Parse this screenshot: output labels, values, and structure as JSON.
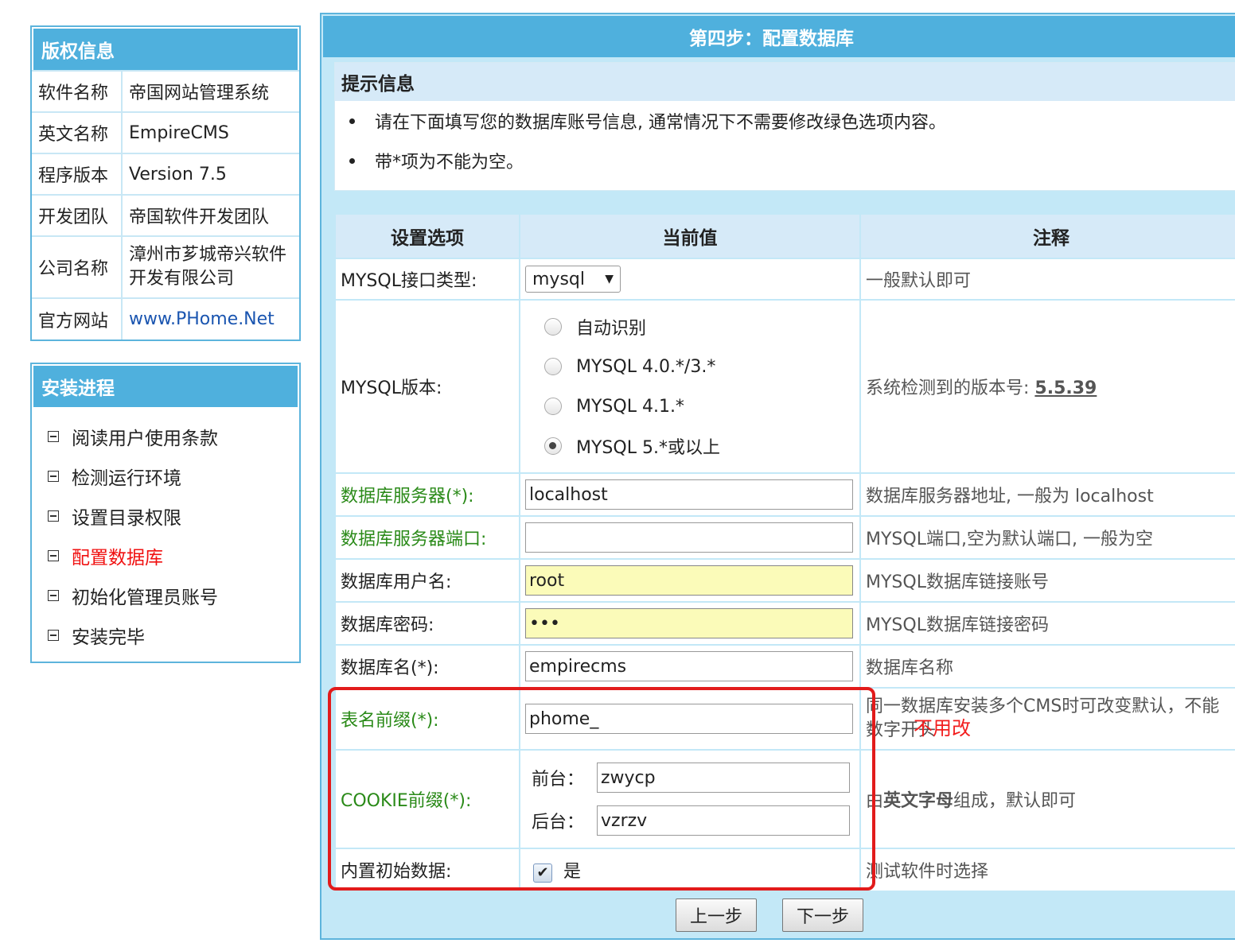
{
  "copyright": {
    "title": "版权信息",
    "rows": [
      {
        "key": "软件名称",
        "value": "帝国网站管理系统"
      },
      {
        "key": "英文名称",
        "value": "EmpireCMS"
      },
      {
        "key": "程序版本",
        "value": "Version 7.5"
      },
      {
        "key": "开发团队",
        "value": "帝国软件开发团队"
      },
      {
        "key": "公司名称",
        "value": "漳州市芗城帝兴软件开发有限公司"
      },
      {
        "key": "官方网站",
        "value": "www.PHome.Net"
      }
    ]
  },
  "progress": {
    "title": "安装进程",
    "steps": [
      "阅读用户使用条款",
      "检测运行环境",
      "设置目录权限",
      "配置数据库",
      "初始化管理员账号",
      "安装完毕"
    ],
    "active_index": 3,
    "active_color": "#f01010"
  },
  "main": {
    "title": "第四步：配置数据库",
    "tips_title": "提示信息",
    "tips": [
      "请在下面填写您的数据库账号信息, 通常情况下不需要修改绿色选项内容。",
      "带*项为不能为空。"
    ],
    "headers": [
      "设置选项",
      "当前值",
      "注释"
    ],
    "interface": {
      "label": "MYSQL接口类型:",
      "selected": "mysql",
      "note": "一般默认即可"
    },
    "version": {
      "label": "MYSQL版本:",
      "options": [
        "自动识别",
        "MYSQL 4.0.*/3.*",
        "MYSQL 4.1.*",
        "MYSQL 5.*或以上"
      ],
      "selected_index": 3,
      "note_prefix": "系统检测到的版本号: ",
      "detected": "5.5.39"
    },
    "server": {
      "label": "数据库服务器(*):",
      "value": "localhost",
      "note": "数据库服务器地址, 一般为 localhost"
    },
    "port": {
      "label": "数据库服务器端口:",
      "value": "",
      "note": "MYSQL端口,空为默认端口, 一般为空"
    },
    "user": {
      "label": "数据库用户名:",
      "value": "root",
      "note": "MYSQL数据库链接账号"
    },
    "password": {
      "label": "数据库密码:",
      "value": "•••",
      "note": "MYSQL数据库链接密码"
    },
    "dbname": {
      "label": "数据库名(*):",
      "value": "empirecms",
      "note": "数据库名称"
    },
    "prefix": {
      "label": "表名前缀(*):",
      "value": "phome_",
      "note": "同一数据库安装多个CMS时可改变默认，不能数字开头"
    },
    "cookie": {
      "label": "COOKIE前缀(*):",
      "front_label": "前台：",
      "front_value": "zwycp",
      "back_label": "后台：",
      "back_value": "vzrzv",
      "note_bold": "英文字母",
      "note_prefix": "由",
      "note_suffix": "组成，默认即可"
    },
    "initdata": {
      "label": "内置初始数据:",
      "checked": true,
      "check_text": "是",
      "note": "测试软件时选择"
    },
    "buttons": {
      "prev": "上一步",
      "next": "下一步"
    },
    "annotation": "不用改",
    "colors": {
      "accent": "#4fb0dd",
      "green_label": "#2a8a18",
      "highlight_box": "#e21b1b"
    }
  }
}
